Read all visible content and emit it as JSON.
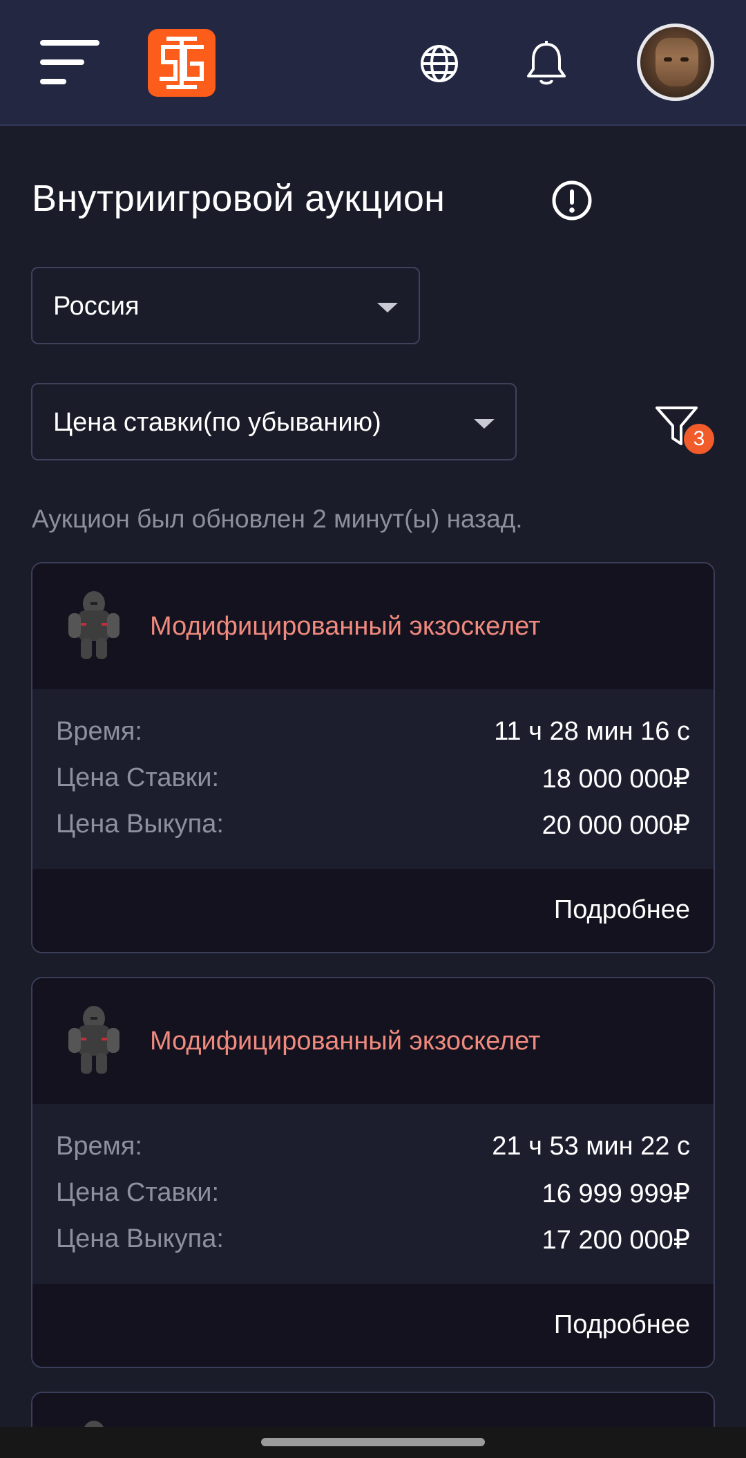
{
  "header": {
    "menu_icon": "hamburger-menu-icon",
    "logo_icon": "brand-logo-icon",
    "language_icon": "globe-icon",
    "notifications_icon": "bell-icon",
    "avatar_icon": "user-avatar"
  },
  "page": {
    "title": "Внутриигровой аукцион",
    "info_icon": "info-icon",
    "updated_text": "Аукцион был обновлен 2 минут(ы) назад."
  },
  "filters": {
    "server_value": "Россия",
    "sort_value": "Цена ставки(по убыванию)",
    "filter_count": "3"
  },
  "colors": {
    "background": "#1a1c29",
    "header": "#242741",
    "accent": "#fc5d1a",
    "item_name": "#f08a7e"
  },
  "lots": [
    {
      "name": "Модифицированный экзоскелет",
      "time_label": "Время:",
      "time_value": "11 ч 28 мин 16 с",
      "bid_label": "Цена Ставки:",
      "bid_value": "18 000 000₽",
      "buyout_label": "Цена Выкупа:",
      "buyout_value": "20 000 000₽",
      "more_label": "Подробнее"
    },
    {
      "name": "Модифицированный экзоскелет",
      "time_label": "Время:",
      "time_value": "21 ч 53 мин 22 с",
      "bid_label": "Цена Ставки:",
      "bid_value": "16 999 999₽",
      "buyout_label": "Цена Выкупа:",
      "buyout_value": "17 200 000₽",
      "more_label": "Подробнее"
    }
  ]
}
